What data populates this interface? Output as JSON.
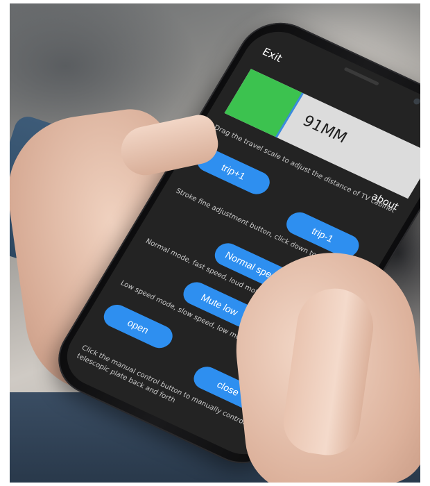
{
  "app": {
    "exit_label": "Exit",
    "about_label": "about",
    "scale_value": "91MM",
    "scale_fraction": 0.28,
    "scale_desc": "Drag the travel scale to adjust the distance of TV cabinet",
    "trip_plus_label": "trip+1",
    "trip_minus_label": "trip-1",
    "stroke_desc": "Stroke fine adjustment button, click down to enter 1mm",
    "normal_speed_label": "Normal speed",
    "normal_desc": "Normal mode, fast speed, loud motor sound",
    "mute_low_label": "Mute low",
    "low_desc": "Low speed mode, slow speed, low motor sound",
    "open_label": "open",
    "close_label": "close",
    "manual_desc": "Click the manual control button to manually control the telescopic plate back and forth"
  },
  "colors": {
    "screen_bg": "#232323",
    "scale_fill": "#3cc24f",
    "scale_track": "#dcdcdc",
    "button_bg": "#2e8ff0",
    "text_white": "#ffffff",
    "text_desc": "#c9c9c9"
  }
}
